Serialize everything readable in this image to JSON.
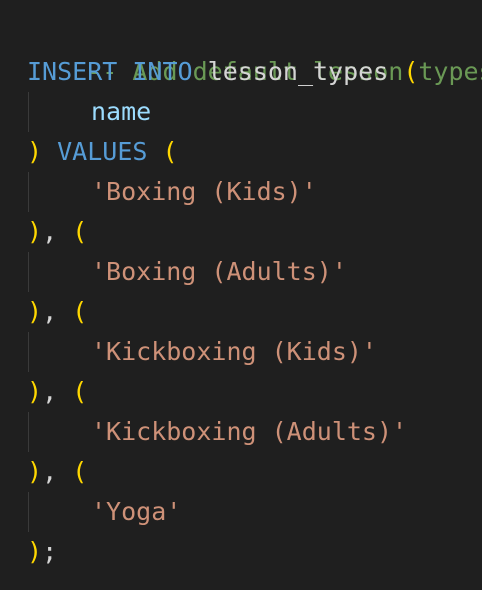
{
  "editor": {
    "comment": "-- Add default lesson types",
    "insert_keyword": "INSERT INTO",
    "table_name": "lesson_types",
    "column_name": "name",
    "values_keyword": "VALUES",
    "values": [
      "'Boxing (Kids)'",
      "'Boxing (Adults)'",
      "'Kickboxing (Kids)'",
      "'Kickboxing (Adults)'",
      "'Yoga'"
    ],
    "open_paren": "(",
    "close_paren": ")",
    "separator_comma": ",",
    "terminator": ";"
  },
  "colors": {
    "background": "#1f1f1f",
    "comment": "#6a9955",
    "keyword": "#569cd6",
    "identifier": "#d4d4d4",
    "column": "#9cdcfe",
    "bracket": "#ffd700",
    "string": "#ce9178"
  }
}
